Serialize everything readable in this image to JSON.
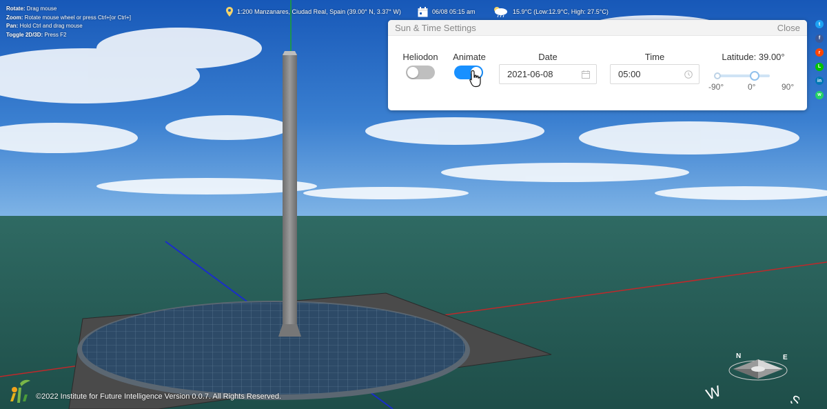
{
  "help": {
    "rotate_label": "Rotate:",
    "rotate_text": "Drag mouse",
    "zoom_label": "Zoom:",
    "zoom_text": "Rotate mouse wheel or press Ctrl+[or Ctrl+]",
    "pan_label": "Pan:",
    "pan_text": "Hold Ctrl and drag mouse",
    "toggle_label": "Toggle 2D/3D:",
    "toggle_text": "Press F2"
  },
  "info": {
    "location": "1:200 Manzanares, Ciudad Real, Spain (39.00° N, 3.37° W)",
    "datetime": "06/08 05:15 am",
    "weather": "15.9°C (Low:12.9°C, High: 27.5°C)"
  },
  "panel": {
    "title": "Sun & Time Settings",
    "close_label": "Close",
    "heliodon_label": "Heliodon",
    "heliodon_on": false,
    "animate_label": "Animate",
    "animate_on": true,
    "date_label": "Date",
    "date_value": "2021-06-08",
    "time_label": "Time",
    "time_value": "05:00",
    "latitude_label": "Latitude: 39.00°",
    "latitude_value": 39,
    "latitude_marks": [
      "-90°",
      "0°",
      "90°"
    ]
  },
  "share": [
    {
      "name": "twitter-icon",
      "color": "#1da1f2",
      "glyph": "t"
    },
    {
      "name": "facebook-icon",
      "color": "#3b5998",
      "glyph": "f"
    },
    {
      "name": "reddit-icon",
      "color": "#ff4500",
      "glyph": "r"
    },
    {
      "name": "line-icon",
      "color": "#00c300",
      "glyph": "L"
    },
    {
      "name": "linkedin-icon",
      "color": "#0077b5",
      "glyph": "in"
    },
    {
      "name": "whatsapp-icon",
      "color": "#25d366",
      "glyph": "w"
    }
  ],
  "footer": "©2022 Institute for Future Intelligence Version 0.0.7. All Rights Reserved.",
  "colors": {
    "accent": "#1890ff",
    "switch_off": "#bfbfbf"
  }
}
